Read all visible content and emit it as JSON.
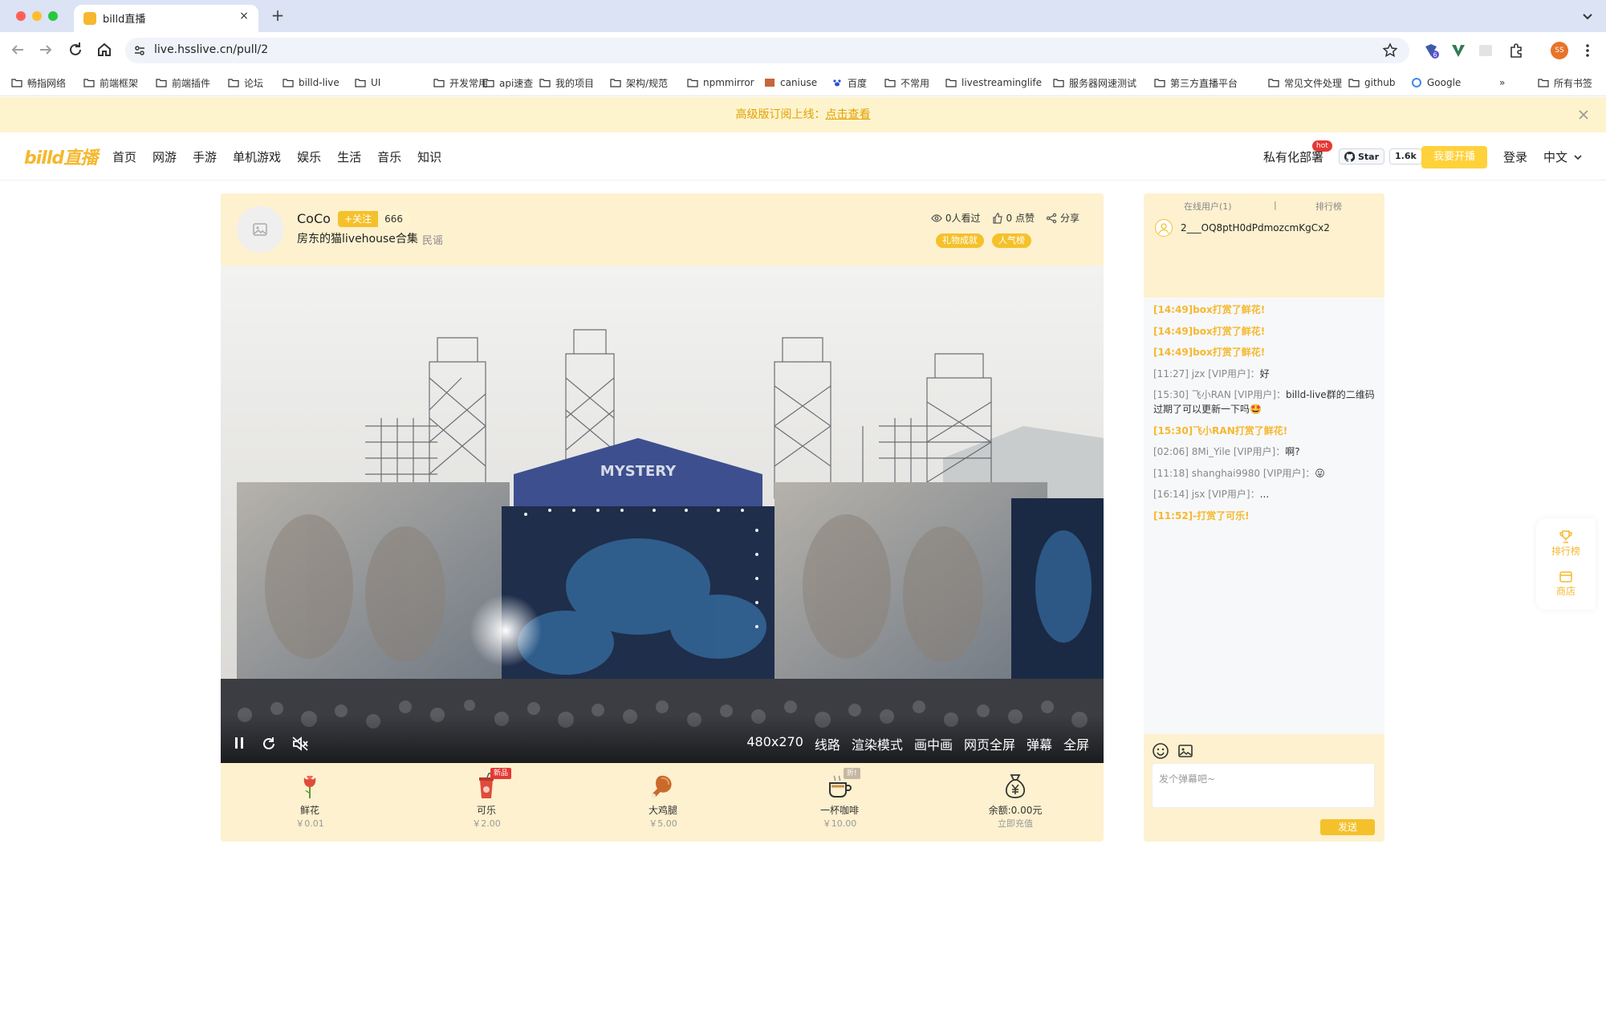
{
  "browser": {
    "tab_title": "billd直播",
    "tab_close": "×",
    "new_tab": "+",
    "url": "live.hsslive.cn/pull/2",
    "profile_initials": "SS",
    "extension_badge": "6",
    "bookmarks": [
      "畅指网络",
      "前端框架",
      "前端插件",
      "论坛",
      "billd-live",
      "UI",
      "开发常用",
      "api速查",
      "我的项目",
      "架构/规范",
      "npmmirror",
      "caniuse",
      "百度",
      "不常用",
      "livestreaminglife",
      "服务器网速测试",
      "第三方直播平台",
      "常见文件处理",
      "github",
      "Google"
    ],
    "bookmarks_more": "»",
    "all_bookmarks": "所有书签"
  },
  "notice": {
    "text": "高级版订阅上线：",
    "link": "点击查看"
  },
  "header": {
    "logo": "billd直播",
    "nav": [
      "首页",
      "网游",
      "手游",
      "单机游戏",
      "娱乐",
      "生活",
      "音乐",
      "知识"
    ],
    "private_deploy": "私有化部署",
    "hot": "hot",
    "github_star": "Star",
    "github_count": "1.6k",
    "start_live": "我要开播",
    "login": "登录",
    "language": "中文"
  },
  "room": {
    "anchor_name": "CoCo",
    "follow": "+关注",
    "follow_count": "666",
    "title": "房东的猫livehouse合集",
    "category": "民谣",
    "views": "0人看过",
    "likes": "0 点赞",
    "share": "分享",
    "badges": [
      "礼物成就",
      "人气榜"
    ]
  },
  "player": {
    "resolution": "480x270",
    "controls": [
      "线路",
      "渲染模式",
      "画中画",
      "网页全屏",
      "弹幕",
      "全屏"
    ],
    "stage_sign": "MYSTERY"
  },
  "gifts": [
    {
      "name": "鲜花",
      "price": "￥0.01",
      "icon": "flower-icon",
      "tag": ""
    },
    {
      "name": "可乐",
      "price": "￥2.00",
      "icon": "cola-icon",
      "tag": "新品"
    },
    {
      "name": "大鸡腿",
      "price": "￥5.00",
      "icon": "drumstick-icon",
      "tag": ""
    },
    {
      "name": "一杯咖啡",
      "price": "￥10.00",
      "icon": "coffee-icon",
      "tag": "折!"
    },
    {
      "name": "余额:0.00元",
      "price": "立即充值",
      "icon": "money-bag-icon",
      "tag": ""
    }
  ],
  "side": {
    "tab_online": "在线用户(1)",
    "tab_sep": "|",
    "tab_rank": "排行榜",
    "online_user": "2___OQ8ptH0dPdmozcmKgCx2",
    "messages": [
      {
        "kind": "gift",
        "text": "[14:49]box打赏了鲜花!"
      },
      {
        "kind": "gift",
        "text": "[14:49]box打赏了鲜花!"
      },
      {
        "kind": "gift",
        "text": "[14:49]box打赏了鲜花!"
      },
      {
        "kind": "chat",
        "meta": "[11:27] jzx [VIP用户]：",
        "text": "好"
      },
      {
        "kind": "chat",
        "meta": "[15:30] 飞小RAN [VIP用户]：",
        "text": "billd-live群的二维码过期了可以更新一下吗🤩"
      },
      {
        "kind": "gift",
        "text": "[15:30]飞小RAN打赏了鲜花!"
      },
      {
        "kind": "chat",
        "meta": "[02:06] 8Mi_Yile [VIP用户]：",
        "text": "啊?"
      },
      {
        "kind": "chat",
        "meta": "[11:18] shanghai9980 [VIP用户]：",
        "text": "😛"
      },
      {
        "kind": "chat",
        "meta": "[16:14] jsx [VIP用户]：",
        "text": "..."
      },
      {
        "kind": "gift",
        "text": "[11:52]-打赏了可乐!"
      }
    ],
    "input_placeholder": "发个弹幕吧~",
    "send": "发送"
  },
  "floater": {
    "rank": "排行榜",
    "shop": "商店"
  },
  "colors": {
    "accent": "#f5c12b",
    "notice_bg": "#fdf3cd",
    "card_bg": "#fdf1cf",
    "hot": "#e53935"
  }
}
